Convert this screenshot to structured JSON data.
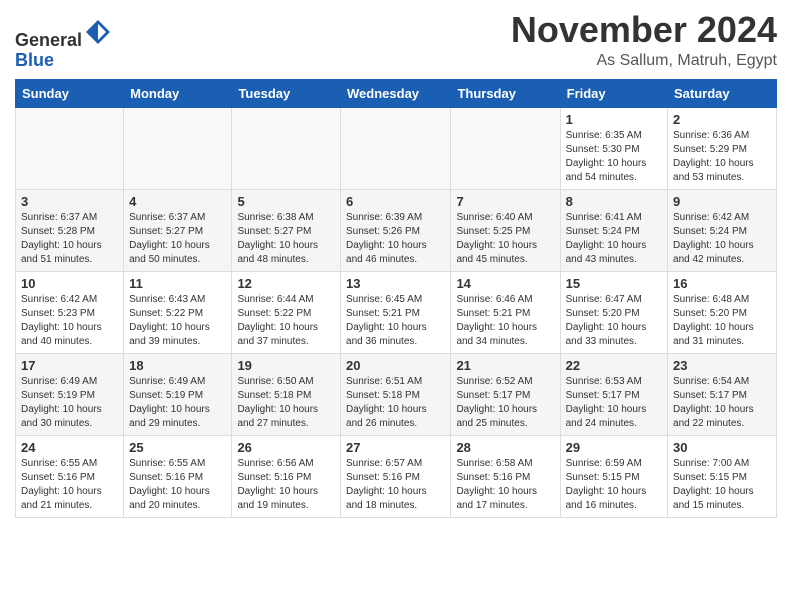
{
  "header": {
    "logo": {
      "line1": "General",
      "line2": "Blue"
    },
    "title": "November 2024",
    "location": "As Sallum, Matruh, Egypt"
  },
  "weekdays": [
    "Sunday",
    "Monday",
    "Tuesday",
    "Wednesday",
    "Thursday",
    "Friday",
    "Saturday"
  ],
  "weeks": [
    [
      {
        "day": "",
        "info": ""
      },
      {
        "day": "",
        "info": ""
      },
      {
        "day": "",
        "info": ""
      },
      {
        "day": "",
        "info": ""
      },
      {
        "day": "",
        "info": ""
      },
      {
        "day": "1",
        "info": "Sunrise: 6:35 AM\nSunset: 5:30 PM\nDaylight: 10 hours\nand 54 minutes."
      },
      {
        "day": "2",
        "info": "Sunrise: 6:36 AM\nSunset: 5:29 PM\nDaylight: 10 hours\nand 53 minutes."
      }
    ],
    [
      {
        "day": "3",
        "info": "Sunrise: 6:37 AM\nSunset: 5:28 PM\nDaylight: 10 hours\nand 51 minutes."
      },
      {
        "day": "4",
        "info": "Sunrise: 6:37 AM\nSunset: 5:27 PM\nDaylight: 10 hours\nand 50 minutes."
      },
      {
        "day": "5",
        "info": "Sunrise: 6:38 AM\nSunset: 5:27 PM\nDaylight: 10 hours\nand 48 minutes."
      },
      {
        "day": "6",
        "info": "Sunrise: 6:39 AM\nSunset: 5:26 PM\nDaylight: 10 hours\nand 46 minutes."
      },
      {
        "day": "7",
        "info": "Sunrise: 6:40 AM\nSunset: 5:25 PM\nDaylight: 10 hours\nand 45 minutes."
      },
      {
        "day": "8",
        "info": "Sunrise: 6:41 AM\nSunset: 5:24 PM\nDaylight: 10 hours\nand 43 minutes."
      },
      {
        "day": "9",
        "info": "Sunrise: 6:42 AM\nSunset: 5:24 PM\nDaylight: 10 hours\nand 42 minutes."
      }
    ],
    [
      {
        "day": "10",
        "info": "Sunrise: 6:42 AM\nSunset: 5:23 PM\nDaylight: 10 hours\nand 40 minutes."
      },
      {
        "day": "11",
        "info": "Sunrise: 6:43 AM\nSunset: 5:22 PM\nDaylight: 10 hours\nand 39 minutes."
      },
      {
        "day": "12",
        "info": "Sunrise: 6:44 AM\nSunset: 5:22 PM\nDaylight: 10 hours\nand 37 minutes."
      },
      {
        "day": "13",
        "info": "Sunrise: 6:45 AM\nSunset: 5:21 PM\nDaylight: 10 hours\nand 36 minutes."
      },
      {
        "day": "14",
        "info": "Sunrise: 6:46 AM\nSunset: 5:21 PM\nDaylight: 10 hours\nand 34 minutes."
      },
      {
        "day": "15",
        "info": "Sunrise: 6:47 AM\nSunset: 5:20 PM\nDaylight: 10 hours\nand 33 minutes."
      },
      {
        "day": "16",
        "info": "Sunrise: 6:48 AM\nSunset: 5:20 PM\nDaylight: 10 hours\nand 31 minutes."
      }
    ],
    [
      {
        "day": "17",
        "info": "Sunrise: 6:49 AM\nSunset: 5:19 PM\nDaylight: 10 hours\nand 30 minutes."
      },
      {
        "day": "18",
        "info": "Sunrise: 6:49 AM\nSunset: 5:19 PM\nDaylight: 10 hours\nand 29 minutes."
      },
      {
        "day": "19",
        "info": "Sunrise: 6:50 AM\nSunset: 5:18 PM\nDaylight: 10 hours\nand 27 minutes."
      },
      {
        "day": "20",
        "info": "Sunrise: 6:51 AM\nSunset: 5:18 PM\nDaylight: 10 hours\nand 26 minutes."
      },
      {
        "day": "21",
        "info": "Sunrise: 6:52 AM\nSunset: 5:17 PM\nDaylight: 10 hours\nand 25 minutes."
      },
      {
        "day": "22",
        "info": "Sunrise: 6:53 AM\nSunset: 5:17 PM\nDaylight: 10 hours\nand 24 minutes."
      },
      {
        "day": "23",
        "info": "Sunrise: 6:54 AM\nSunset: 5:17 PM\nDaylight: 10 hours\nand 22 minutes."
      }
    ],
    [
      {
        "day": "24",
        "info": "Sunrise: 6:55 AM\nSunset: 5:16 PM\nDaylight: 10 hours\nand 21 minutes."
      },
      {
        "day": "25",
        "info": "Sunrise: 6:55 AM\nSunset: 5:16 PM\nDaylight: 10 hours\nand 20 minutes."
      },
      {
        "day": "26",
        "info": "Sunrise: 6:56 AM\nSunset: 5:16 PM\nDaylight: 10 hours\nand 19 minutes."
      },
      {
        "day": "27",
        "info": "Sunrise: 6:57 AM\nSunset: 5:16 PM\nDaylight: 10 hours\nand 18 minutes."
      },
      {
        "day": "28",
        "info": "Sunrise: 6:58 AM\nSunset: 5:16 PM\nDaylight: 10 hours\nand 17 minutes."
      },
      {
        "day": "29",
        "info": "Sunrise: 6:59 AM\nSunset: 5:15 PM\nDaylight: 10 hours\nand 16 minutes."
      },
      {
        "day": "30",
        "info": "Sunrise: 7:00 AM\nSunset: 5:15 PM\nDaylight: 10 hours\nand 15 minutes."
      }
    ]
  ]
}
